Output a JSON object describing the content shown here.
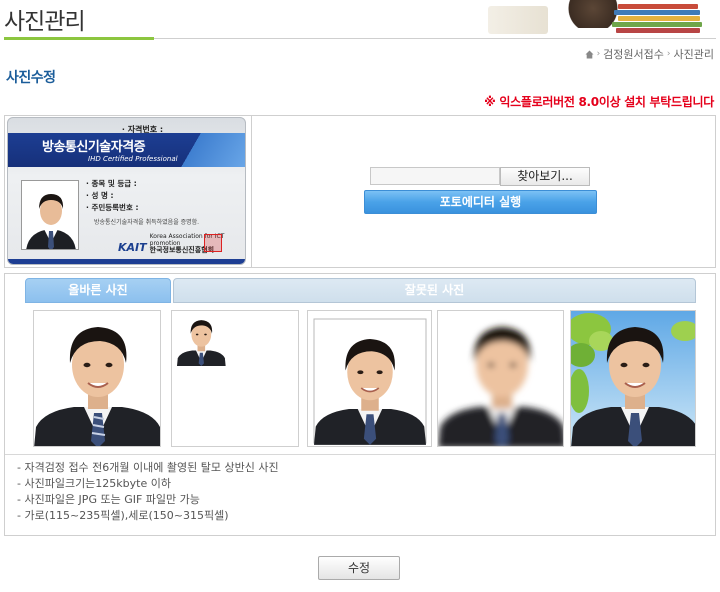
{
  "header": {
    "title": "사진관리"
  },
  "breadcrumb": {
    "items": [
      "검정원서접수",
      "사진관리"
    ]
  },
  "section": {
    "title": "사진수정"
  },
  "notice": "※ 익스플로러버전 8.0이상 설치 부탁드립니다",
  "certificate": {
    "number_label": "· 자격번호 :",
    "title": "방송통신기술자격증",
    "subtitle": "IHD Certified Professional",
    "fields": [
      "· 종목 및 등급 :",
      "· 성          명 :",
      "· 주민등록번호 :"
    ],
    "description": "방송통신기술자격을 취득하였음을 증명함.",
    "org_abbr": "KAIT",
    "org_english": "Korea Association for ICT promotion",
    "org_korean": "한국정보통신진흥협회"
  },
  "upload": {
    "file_value": "",
    "browse_label": "찾아보기...",
    "editor_label": "포토에디터 실행"
  },
  "examples": {
    "tab_correct": "올바른 사진",
    "tab_wrong": "잘못된 사진"
  },
  "guidelines": [
    "- 자격검정 접수 전6개월 이내에 촬영된 탈모 상반신 사진",
    "- 사진파일크기는125kbyte 이하",
    "- 사진파일은 JPG 또는 GIF 파일만 가능",
    "- 가로(115~235픽셀),세로(150~315픽셀)"
  ],
  "actions": {
    "submit_label": "수정"
  },
  "colors": {
    "accent_green": "#8cc63f",
    "title_blue": "#1b5d9a",
    "notice_red": "#e5001b"
  }
}
